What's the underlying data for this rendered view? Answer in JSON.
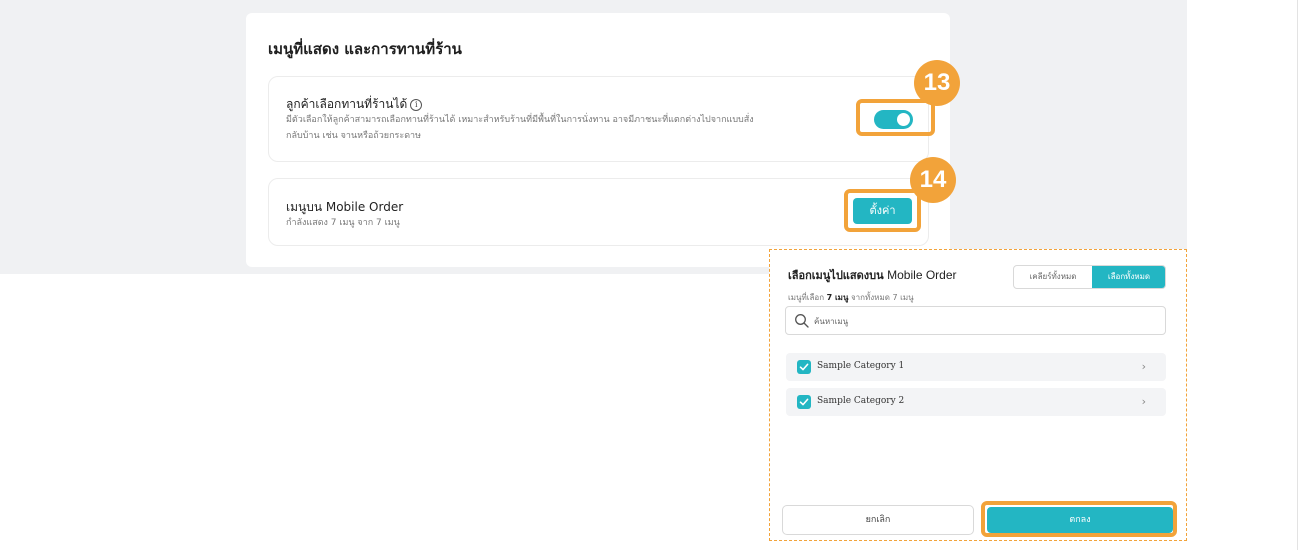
{
  "main": {
    "title": "เมนูที่แสดง และการทานที่ร้าน",
    "dine_in": {
      "title": "ลูกค้าเลือกทานที่ร้านได้",
      "info_icon": "i",
      "desc_line1": "มีตัวเลือกให้ลูกค้าสามารถเลือกทานที่ร้านได้ เหมาะสำหรับร้านที่มีพื้นที่ในการนั่งทาน อาจมีภาชนะที่แตกต่างไปจากแบบสั่ง",
      "desc_line2": "กลับบ้าน เช่น จานหรือถ้วยกระดาษ",
      "toggle_on": true
    },
    "mobile_order": {
      "title": "เมนูบน Mobile Order",
      "status": "กำลังแสดง 7 เมนู จาก 7 เมนู",
      "setting_label": "ตั้งค่า"
    }
  },
  "badges": {
    "step13": "13",
    "step14": "14"
  },
  "modal": {
    "title_bold": "เลือกเมนูไปแสดงบน",
    "title_rest": "Mobile Order",
    "sub_prefix": "เมนูที่เลือก",
    "sub_count": "7 เมนู",
    "sub_suffix": "จากทั้งหมด 7 เมนู",
    "clear_all": "เคลียร์ทั้งหมด",
    "select_all": "เลือกทั้งหมด",
    "search_placeholder": "ค้นหาเมนู",
    "categories": [
      {
        "label": "Sample Category 1",
        "checked": true
      },
      {
        "label": "Sample Category 2",
        "checked": true
      }
    ],
    "cancel_label": "ยกเลิก",
    "ok_label": "ตกลง"
  },
  "colors": {
    "accent": "#23b6c3",
    "highlight": "#f2a33a",
    "background": "#f0f1f3"
  },
  "icons": [
    "info-icon",
    "search-icon",
    "checkbox-checked-icon",
    "chevron-right-icon"
  ]
}
